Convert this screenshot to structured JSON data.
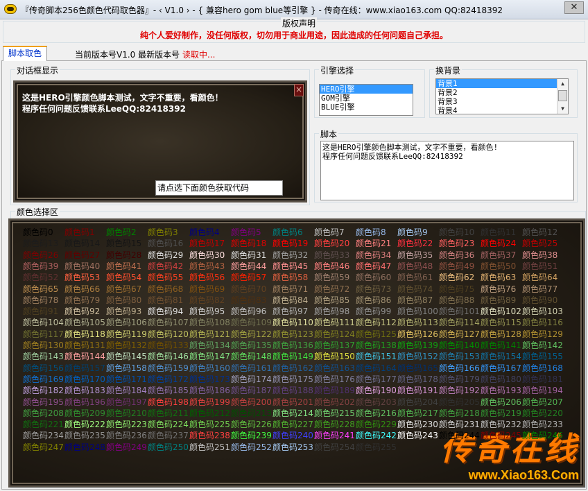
{
  "window": {
    "title": "『传奇脚本256色颜色代码取色器』- ‹ V1.0 › - { 兼容hero gom blue等引擎 } -  传奇在线：www.xiao163.com    QQ:82418392",
    "close_glyph": "✕"
  },
  "notice": {
    "legend": "版权声明",
    "text": "纯个人爱好制作，没任何版权，切勿用于商业用途，因此造成的任何问题自己承担。"
  },
  "tabs": [
    {
      "label": "脚本取色"
    }
  ],
  "version": {
    "prefix": "当前版本号V1.0 最新版本号 ",
    "status": "读取中..."
  },
  "dialog": {
    "legend": "对话框显示",
    "close_glyph": "×",
    "lines": [
      "这是HERO引擎颜色脚本测试，文字不重要，看颜色！",
      "程序任何问题反馈联系LeeQQ:82418392"
    ],
    "input_value": "请点选下面颜色获取代码"
  },
  "engine": {
    "legend": "引擎选择",
    "items": [
      "HERO引擎",
      "GOM引擎",
      "BLUE引擎"
    ],
    "selected": 0
  },
  "background": {
    "legend": "换背景",
    "items": [
      "背景1",
      "背景2",
      "背景3",
      "背景4"
    ],
    "selected": 0
  },
  "script": {
    "legend": "脚本",
    "text": "这是HERO引擎颜色脚本测试，文字不重要，看颜色!\n程序任何问题反馈联系LeeQQ:82418392"
  },
  "colors": {
    "legend": "颜色选择区",
    "label_prefix": "颜色码",
    "count": 256,
    "palette": [
      "#000000",
      "#800000",
      "#008000",
      "#808000",
      "#000080",
      "#800080",
      "#008080",
      "#c0c0c0",
      "#97b9ea",
      "#a4c8f0",
      "#404040",
      "#303030",
      "#505050",
      "#1c1c1c",
      "#181818",
      "#141414",
      "#505050",
      "#c00000",
      "#e00000",
      "#ff0000",
      "#ff4040",
      "#ff8080",
      "#ff3040",
      "#ff6060",
      "#ff0000",
      "#c00000",
      "#800000",
      "#600000",
      "#400000",
      "#e0e0e0",
      "#ffe0e0",
      "#e0e0e0",
      "#a0a0a0",
      "#605050",
      "#e08080",
      "#c0a0a0",
      "#d08080",
      "#a06060",
      "#e09090",
      "#b06060",
      "#a07060",
      "#c07050",
      "#d04040",
      "#b06040",
      "#ffa0a0",
      "#ff9090",
      "#ff8080",
      "#ff7070",
      "#905050",
      "#905040",
      "#805030",
      "#704040",
      "#603030",
      "#ff6040",
      "#ff5030",
      "#ff4020",
      "#ff3010",
      "#ff2000",
      "#e06040",
      "#a08070",
      "#907060",
      "#806050",
      "#f0c080",
      "#e0b070",
      "#d0a060",
      "#c09050",
      "#b08040",
      "#a07030",
      "#906020",
      "#805010",
      "#604020",
      "#a08060",
      "#907050",
      "#706040",
      "#605030",
      "#504020",
      "#c0a080",
      "#b09070",
      "#a08060",
      "#907050",
      "#806040",
      "#705030",
      "#604020",
      "#503010",
      "#c0b090",
      "#b0a080",
      "#a09070",
      "#908060",
      "#807050",
      "#706040",
      "#605030",
      "#504020",
      "#d0c0a0",
      "#c0b090",
      "#e0e0e0",
      "#d0d0d0",
      "#c0c0c0",
      "#b0b0b0",
      "#a0a0a0",
      "#909090",
      "#808080",
      "#707070",
      "#e0e0c0",
      "#d0d0b0",
      "#c0c0a0",
      "#b0b090",
      "#a0a080",
      "#909070",
      "#808060",
      "#707050",
      "#e0e0a0",
      "#d0d090",
      "#c0c080",
      "#b0b070",
      "#a0a060",
      "#909050",
      "#808040",
      "#707030",
      "#e0e080",
      "#d0d070",
      "#c0c060",
      "#b0b050",
      "#a0a040",
      "#909030",
      "#808020",
      "#707010",
      "#e0c060",
      "#d0b050",
      "#c0a040",
      "#b09030",
      "#a08020",
      "#907010",
      "#806000",
      "#705000",
      "#60a060",
      "#50a050",
      "#40a040",
      "#30a030",
      "#20a020",
      "#10a010",
      "#009000",
      "#008000",
      "#60c060",
      "#a0d0a0",
      "#ffa0a0",
      "#c0e0c0",
      "#a0e0a0",
      "#80e080",
      "#60e060",
      "#40e040",
      "#e0e040",
      "#40c0e0",
      "#3090c0",
      "#2080b0",
      "#1070a0",
      "#006090",
      "#005080",
      "#004070",
      "#60a0e0",
      "#5090d0",
      "#4080c0",
      "#3070b0",
      "#2060a0",
      "#105090",
      "#004080",
      "#003070",
      "#40a0ff",
      "#3090f0",
      "#2080e0",
      "#1070d0",
      "#0060c0",
      "#0050b0",
      "#0040a0",
      "#003090",
      "#a0a0c0",
      "#9090b0",
      "#8080a0",
      "#707090",
      "#606080",
      "#505070",
      "#404060",
      "#303050",
      "#c0a0e0",
      "#b090d0",
      "#a080c0",
      "#9070b0",
      "#8060a0",
      "#705090",
      "#604080",
      "#503070",
      "#e0a0e0",
      "#d090d0",
      "#c080c0",
      "#b070b0",
      "#a060a0",
      "#905090",
      "#804080",
      "#703070",
      "#ff4040",
      "#e04040",
      "#c04040",
      "#a04040",
      "#804040",
      "#604040",
      "#404040",
      "#303030",
      "#60c060",
      "#50b050",
      "#40a040",
      "#309030",
      "#208020",
      "#107010",
      "#006000",
      "#005000",
      "#80e080",
      "#70d070",
      "#60c060",
      "#50b050",
      "#40a040",
      "#309030",
      "#208020",
      "#107010",
      "#a0ff80",
      "#90f070",
      "#80e060",
      "#70d050",
      "#60c040",
      "#50b030",
      "#40a020",
      "#309010",
      "#e0e0e0",
      "#d0d0d0",
      "#c0c0c0",
      "#b0b0b0",
      "#a0a0a0",
      "#909090",
      "#808080",
      "#707070",
      "#ff4040",
      "#40ff40",
      "#4040ff",
      "#ff40ff",
      "#40ffff",
      "#ffffff"
    ],
    "footer_brand": "传奇在线",
    "footer_url": "www.Xiao163.Com"
  }
}
